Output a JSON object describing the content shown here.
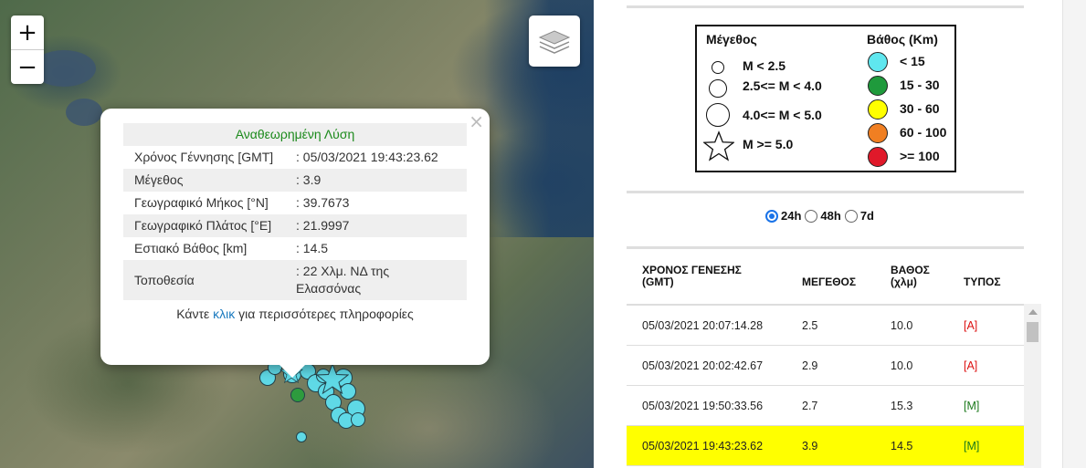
{
  "map": {
    "zoom_in": "+",
    "zoom_out": "−",
    "layers_icon": "layers-icon",
    "popup": {
      "title": "Αναθεωρημένη Λύση",
      "close": "×",
      "rows": [
        {
          "label": "Χρόνος Γέννησης [GMT]",
          "value": ": 05/03/2021 19:43:23.62"
        },
        {
          "label": "Μέγεθος",
          "value": ": 3.9"
        },
        {
          "label": "Γεωγραφικό Μήκος [°N]",
          "value": ": 39.7673"
        },
        {
          "label": "Γεωγραφικό Πλάτος [°E]",
          "value": ": 21.9997"
        },
        {
          "label": "Εστιακό Βάθος [km]",
          "value": ": 14.5"
        },
        {
          "label": "Τοποθεσία",
          "value": ": 22 Χλμ. ΝΔ της Ελασσόνας"
        }
      ],
      "footer_pre": "Κάντε ",
      "footer_link": "κλικ",
      "footer_post": " για περισσότερες πληροφορίες"
    }
  },
  "legend": {
    "magnitude_title": "Μέγεθος",
    "depth_title": "Βάθος (Km)",
    "magnitude": [
      "M < 2.5",
      "2.5<= M < 4.0",
      "4.0<= M < 5.0",
      "M >= 5.0"
    ],
    "depth": [
      {
        "label": "< 15",
        "color": "#5fe7ef"
      },
      {
        "label": "15 - 30",
        "color": "#1f9a3c"
      },
      {
        "label": "30 - 60",
        "color": "#ffff00"
      },
      {
        "label": "60 - 100",
        "color": "#f07f22"
      },
      {
        "label": ">= 100",
        "color": "#e0192a"
      }
    ]
  },
  "period": {
    "options": [
      "24h",
      "48h",
      "7d"
    ],
    "selected": "24h"
  },
  "events": {
    "headers": {
      "time": "ΧΡΟΝΟΣ ΓΕΝΕΣΗΣ (GMT)",
      "mag": "ΜΕΓΕΘΟΣ",
      "depth": "ΒΑΘΟΣ (χλμ)",
      "type": "ΤΥΠΟΣ"
    },
    "rows": [
      {
        "time": "05/03/2021 20:07:14.28",
        "mag": "2.5",
        "depth": "10.0",
        "type": "[A]"
      },
      {
        "time": "05/03/2021 20:02:42.67",
        "mag": "2.9",
        "depth": "10.0",
        "type": "[A]"
      },
      {
        "time": "05/03/2021 19:50:33.56",
        "mag": "2.7",
        "depth": "15.3",
        "type": "[M]"
      },
      {
        "time": "05/03/2021 19:43:23.62",
        "mag": "3.9",
        "depth": "14.5",
        "type": "[M]"
      }
    ],
    "highlight_color": "#ffff00"
  }
}
